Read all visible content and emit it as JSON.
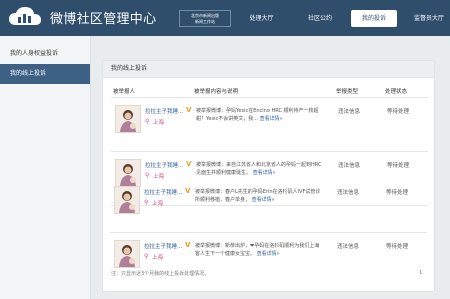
{
  "header": {
    "title": "微博社区管理中心",
    "brand_line1": "北京市新闻出版",
    "brand_line2": "新闻工作站",
    "nav": [
      "处理大厅",
      "社区公约",
      "我的投诉",
      "监督员大厅"
    ],
    "active_nav": "我的投诉"
  },
  "sidebar": {
    "items": [
      "我的人身权益投诉",
      "我的线上投诉"
    ],
    "active": "我的线上投诉"
  },
  "panel": {
    "title": "我的线上投诉",
    "columns": [
      "被举报人",
      "被举报内容与说明",
      "举报类型",
      "处理状态"
    ],
    "rows": [
      {
        "user": "拉拉主子我睡...",
        "location": "上海",
        "desc": "被举报微博：孕妈Yesic在Encino HRC 顺利待产一枚超甜！Yesic不会讲英文，我...",
        "detail": "查看详情»",
        "type": "违法信息",
        "status": "等待处理"
      },
      {
        "user": "拉拉主子我睡...",
        "location": "上海",
        "desc": "被举报微博：来自江苏省人和北京省人的孕妈一起到HRC见面生并顺利健康诞生。",
        "detail": "查看详情»",
        "type": "违法信息",
        "status": "等待处理"
      },
      {
        "user": "拉拉主子我睡...",
        "location": "上海",
        "desc": "被举报微博：春户L先生的孕妈Erin在洛杉矶人IVF试管诊所顺利移植，春户单身，",
        "detail": "查看详情»",
        "type": "违法信息",
        "status": "等待处理"
      },
      {
        "user": "拉拉主子我睡...",
        "location": "上海",
        "desc": "被举报微博：新恭出炉，❤孕妈在洛杉矶顺利为我们上海客人生下一个健康女宝宝。",
        "detail": "查看详情»",
        "type": "违法信息",
        "status": "等待处理"
      }
    ],
    "footnote": "注：只显示近3个月我的线上投诉处理情况。",
    "page": "1"
  },
  "colors": {
    "header_bg": "#2f4e6c",
    "sidebar_active": "#3d6184",
    "link": "#2f5f9a",
    "location": "#d24b7a",
    "vip_badge": "#f29b1d"
  },
  "icons": [
    "cloud-logo-icon",
    "location-pin-icon",
    "vip-v-icon",
    "avatar-photo"
  ]
}
